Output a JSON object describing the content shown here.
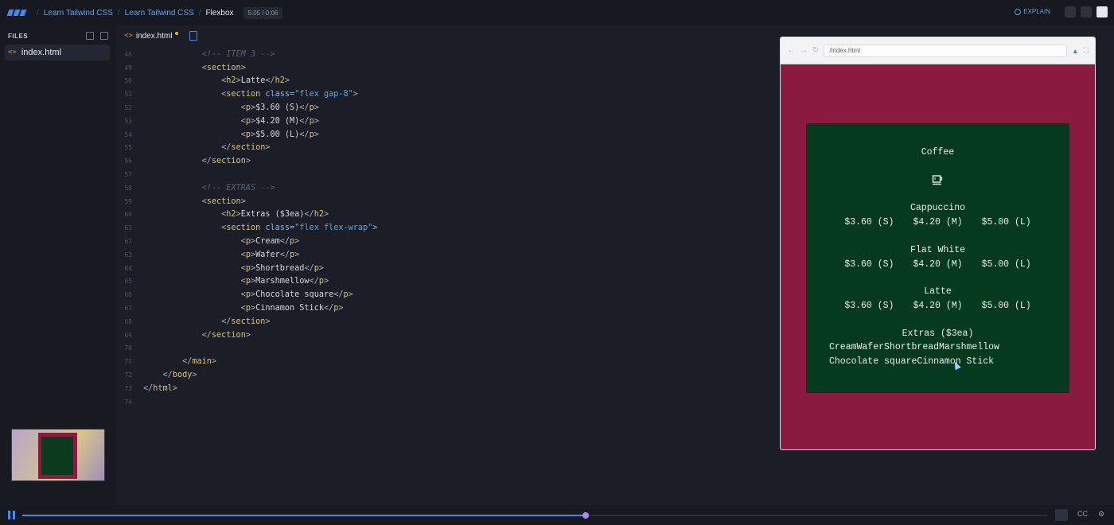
{
  "breadcrumb": {
    "items": [
      "Learn Tailwind CSS",
      "Learn Tailwind CSS",
      "Flexbox"
    ],
    "time": "5:05 / 0:06"
  },
  "topbar": {
    "explain_label": "EXPLAIN"
  },
  "sidebar": {
    "files_label": "FILES",
    "file_name": "index.html"
  },
  "editor": {
    "tab_name": "index.html",
    "lines": [
      {
        "n": "48"
      },
      {
        "n": "49"
      },
      {
        "n": "50"
      },
      {
        "n": "51"
      },
      {
        "n": "52"
      },
      {
        "n": "53"
      },
      {
        "n": "54"
      },
      {
        "n": "55"
      },
      {
        "n": "56"
      },
      {
        "n": "57"
      },
      {
        "n": "58"
      },
      {
        "n": "59"
      },
      {
        "n": "60"
      },
      {
        "n": "61"
      },
      {
        "n": "62"
      },
      {
        "n": "63"
      },
      {
        "n": "64"
      },
      {
        "n": "65"
      },
      {
        "n": "66"
      },
      {
        "n": "67"
      },
      {
        "n": "68"
      },
      {
        "n": "69"
      },
      {
        "n": "70"
      },
      {
        "n": "71"
      },
      {
        "n": "72"
      },
      {
        "n": "73"
      },
      {
        "n": "74"
      }
    ],
    "code": {
      "c48": "<!-- ITEM 3 -->",
      "l50_text": "Latte",
      "l51_class": "\"flex gap-8\"",
      "p1": "$3.60 (S)",
      "p2": "$4.20 (M)",
      "p3": "$5.00 (L)",
      "c58": "<!-- EXTRAS -->",
      "l60_text": "Extras ($3ea)",
      "l61_class": "\"flex flex-wrap\"",
      "e1": "Cream",
      "e2": "Wafer",
      "e3": "Shortbread",
      "e4": "Marshmellow",
      "e5": "Chocolate square",
      "e6": "Cinnamon Stick"
    }
  },
  "preview": {
    "url": "/index.html",
    "menu": {
      "title": "Coffee",
      "items": [
        {
          "name": "Cappuccino",
          "prices": [
            "$3.60 (S)",
            "$4.20 (M)",
            "$5.00 (L)"
          ]
        },
        {
          "name": "Flat White",
          "prices": [
            "$3.60 (S)",
            "$4.20 (M)",
            "$5.00 (L)"
          ]
        },
        {
          "name": "Latte",
          "prices": [
            "$3.60 (S)",
            "$4.20 (M)",
            "$5.00 (L)"
          ]
        }
      ],
      "extras_title": "Extras ($3ea)",
      "extras_line1": "CreamWaferShortbreadMarshmellow",
      "extras_line2": "Chocolate squareCinnamon Stick"
    }
  },
  "player": {
    "progress": 0.55,
    "cc_label": "CC"
  }
}
